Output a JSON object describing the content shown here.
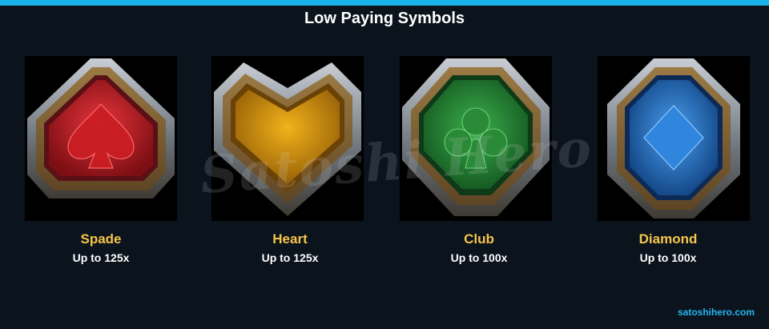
{
  "title": "Low Paying Symbols",
  "symbols": [
    {
      "name": "Spade",
      "payout": "Up to 125x",
      "icon": "spade-icon",
      "color": "#c8262a"
    },
    {
      "name": "Heart",
      "payout": "Up to 125x",
      "icon": "heart-icon",
      "color": "#d79a12"
    },
    {
      "name": "Club",
      "payout": "Up to 100x",
      "icon": "club-icon",
      "color": "#2d9a3c"
    },
    {
      "name": "Diamond",
      "payout": "Up to 100x",
      "icon": "diamond-icon",
      "color": "#2f7fd0"
    }
  ],
  "watermark": "Satoshi Hero",
  "site_link": "satoshihero.com",
  "colors": {
    "background": "#0b131d",
    "accent_bar": "#1ab3ea",
    "symbol_name": "#f6c54a",
    "link": "#27b5f0"
  }
}
